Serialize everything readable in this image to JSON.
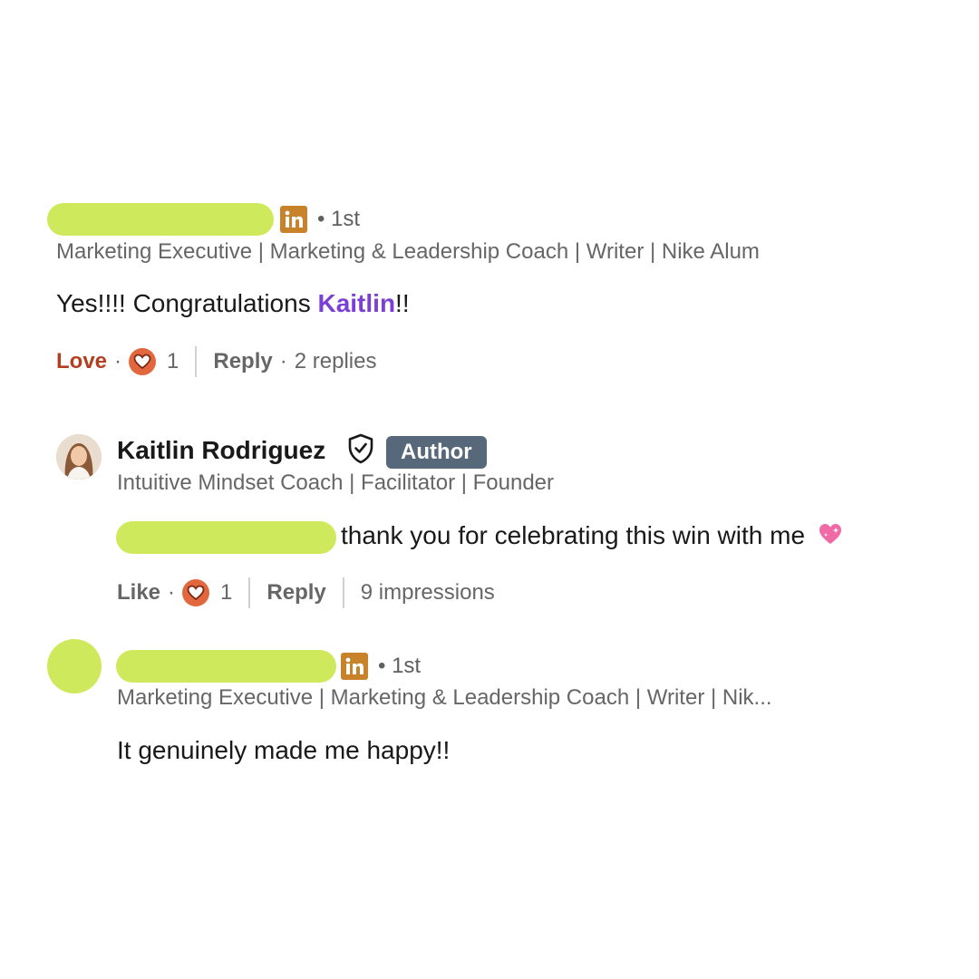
{
  "comment1": {
    "degree": "• 1st",
    "headline": "Marketing Executive | Marketing & Leadership Coach | Writer | Nike Alum",
    "text_before": "Yes!!!! Congratulations ",
    "mention": "Kaitlin",
    "text_after": "!!",
    "actions": {
      "reaction_label": "Love",
      "reaction_count": "1",
      "reply_label": "Reply",
      "replies": "2 replies"
    }
  },
  "reply1": {
    "name": "Kaitlin Rodriguez",
    "badge": "Author",
    "headline": "Intuitive Mindset Coach | Facilitator | Founder",
    "text": "thank you for celebrating this win with me",
    "actions": {
      "reaction_label": "Like",
      "reaction_count": "1",
      "reply_label": "Reply",
      "impressions": "9 impressions"
    }
  },
  "reply2": {
    "degree": "• 1st",
    "headline": "Marketing Executive | Marketing & Leadership Coach | Writer | Nik...",
    "text": "It genuinely made me happy!!"
  },
  "colors": {
    "redaction": "#cfe95d",
    "linkedin_badge": "#c7822a",
    "mention": "#7b3fd6",
    "love": "#b24020",
    "reaction": "#e2673e",
    "author_badge": "#56687a"
  },
  "icons": {
    "linkedin": "linkedin-icon",
    "reaction": "heart-reaction-icon",
    "verified": "verified-shield-icon",
    "emoji": "pink-heart-emoji"
  }
}
